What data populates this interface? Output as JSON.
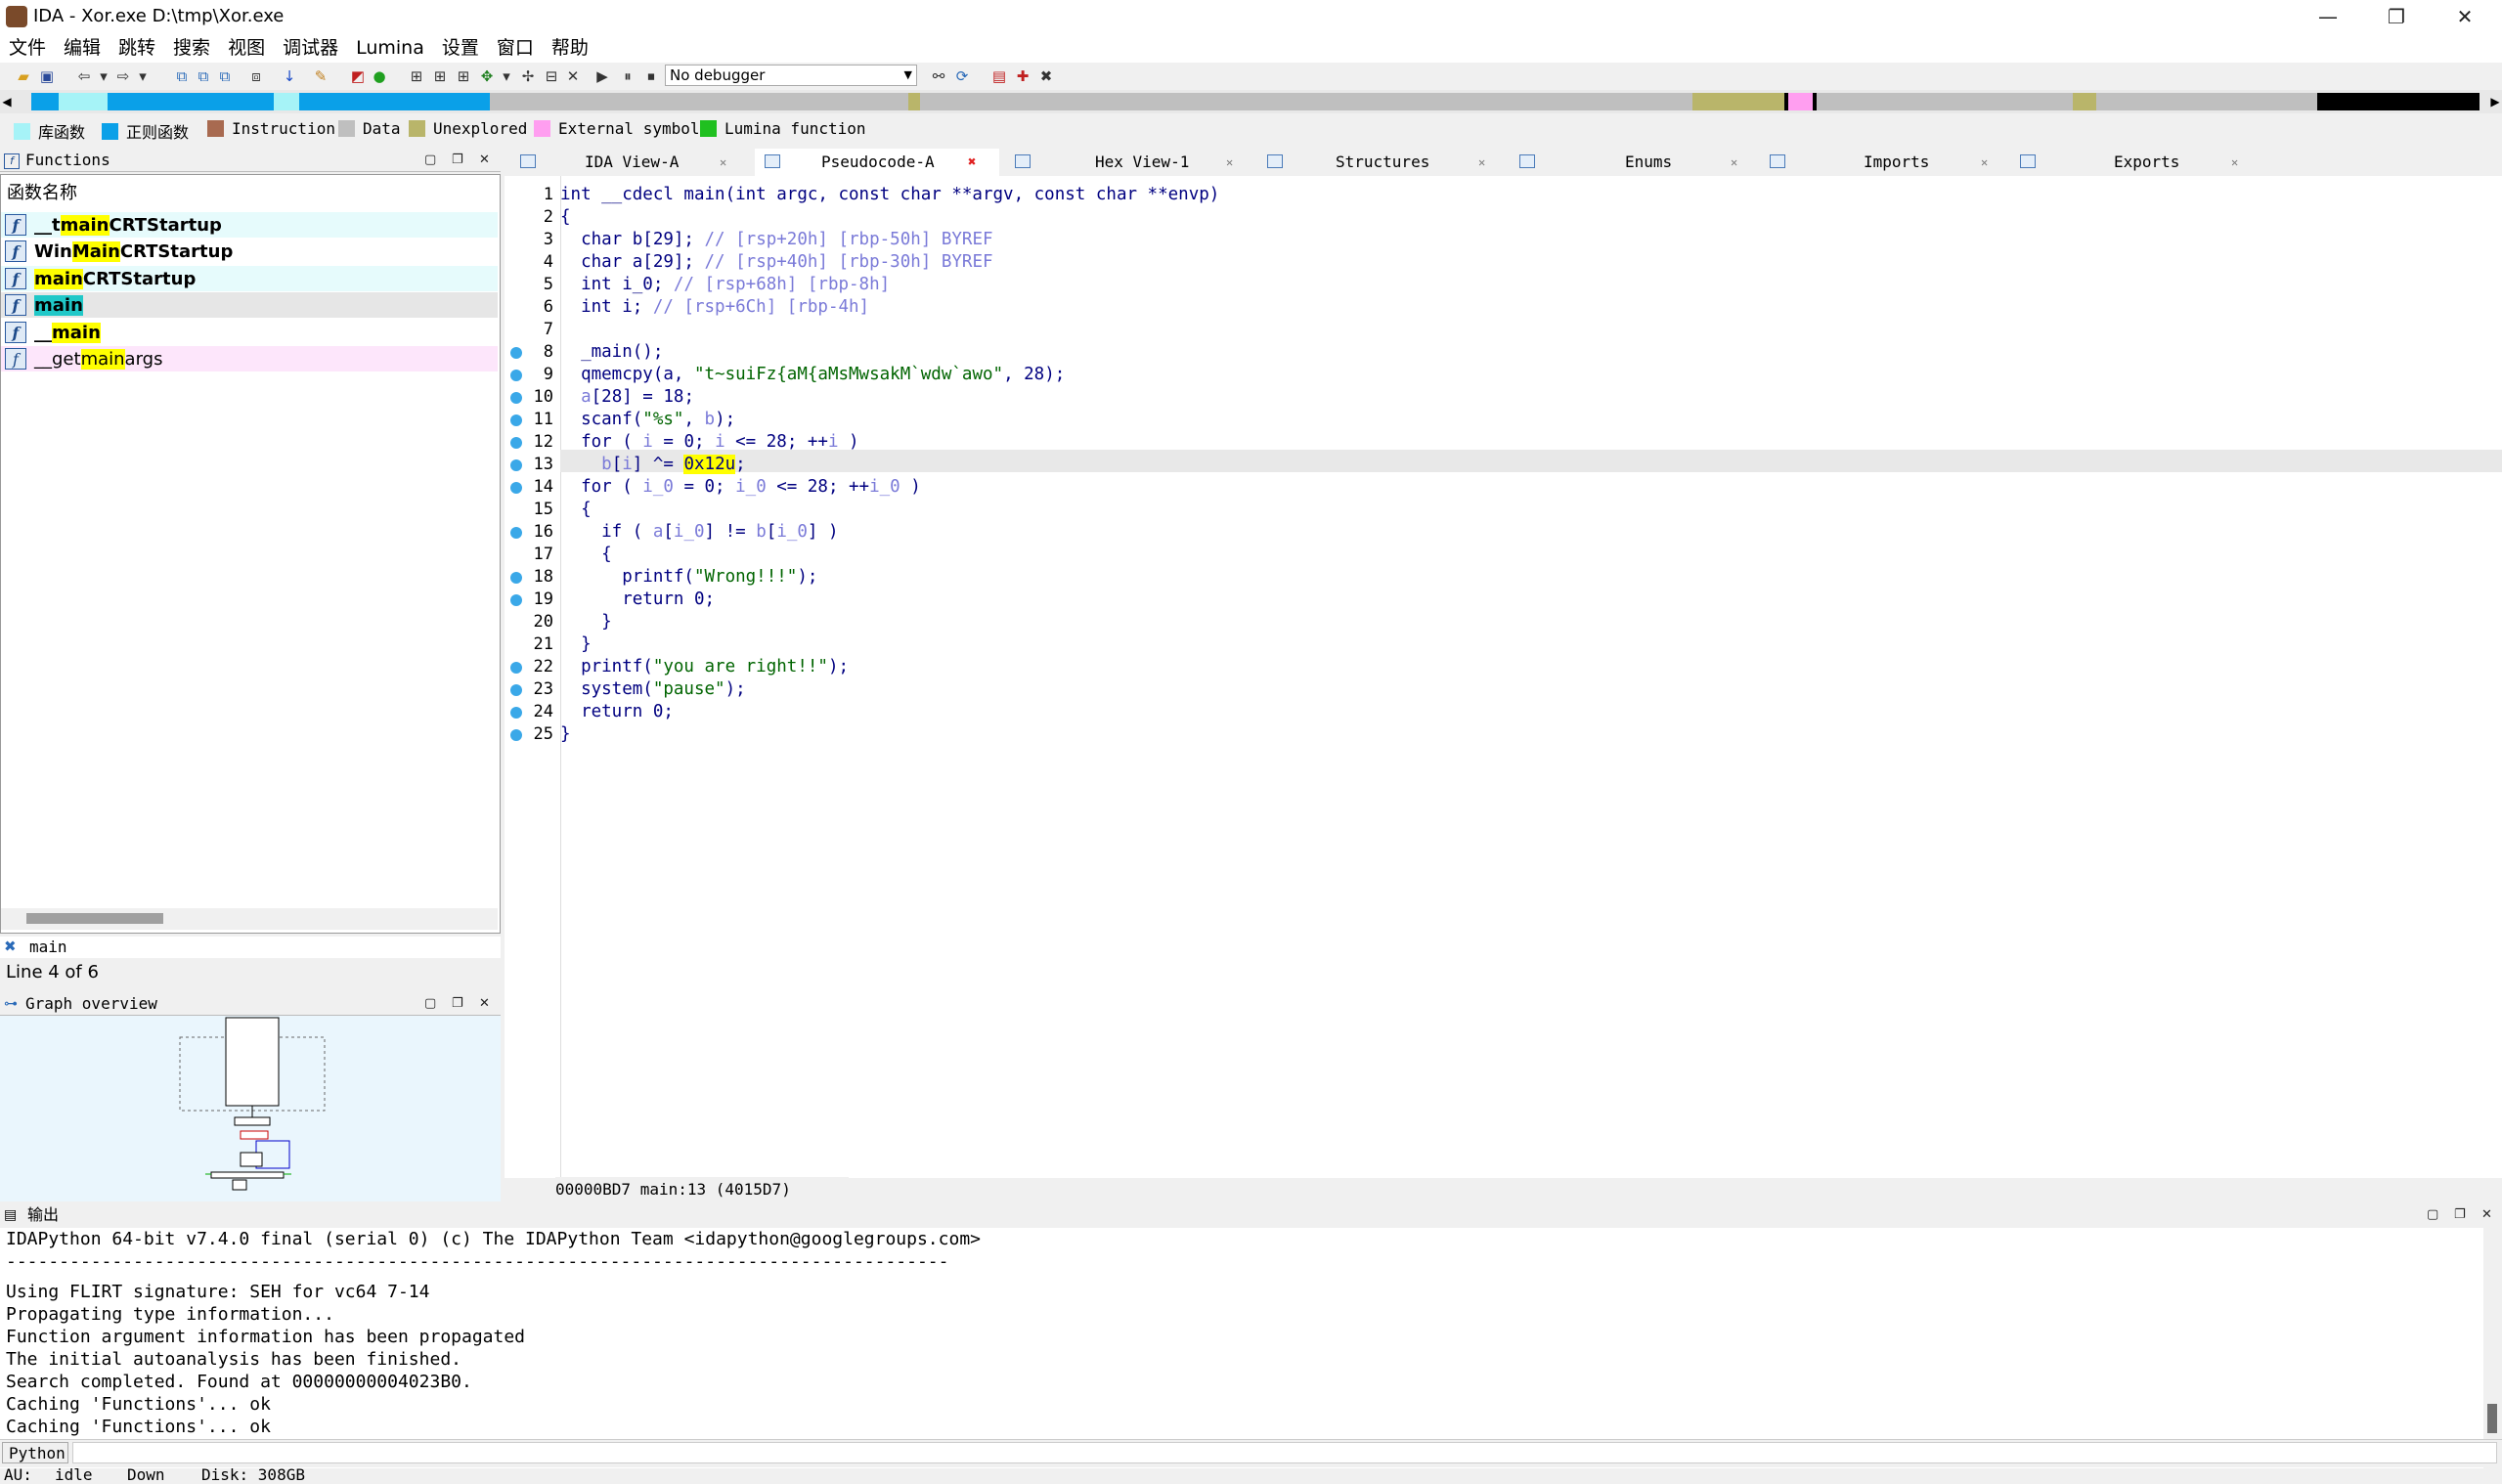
{
  "window": {
    "title": "IDA - Xor.exe D:\\tmp\\Xor.exe",
    "controls": [
      "—",
      "❐",
      "✕"
    ]
  },
  "menu": [
    "文件",
    "编辑",
    "跳转",
    "搜索",
    "视图",
    "调试器",
    "Lumina",
    "设置",
    "窗口",
    "帮助"
  ],
  "toolbar": {
    "debugger": "No debugger"
  },
  "legend": [
    {
      "label": "库函数",
      "color": "#a6f3f7"
    },
    {
      "label": "正则函数",
      "color": "#0aa0e8"
    },
    {
      "label": "Instruction",
      "color": "#a86a50"
    },
    {
      "label": "Data",
      "color": "#bfbfbf"
    },
    {
      "label": "Unexplored",
      "color": "#b9b56a"
    },
    {
      "label": "External symbol",
      "color": "#ff9ef0"
    },
    {
      "label": "Lumina function",
      "color": "#20c020"
    }
  ],
  "functions": {
    "title": "Functions",
    "column_header": "函数名称",
    "items": [
      {
        "pre": "__t",
        "hl": "main",
        "post": "CRTStartup"
      },
      {
        "pre": "Win",
        "hl": "Main",
        "post": "CRTStartup"
      },
      {
        "pre": "",
        "hl": "main",
        "post": "CRTStartup"
      },
      {
        "pre": "",
        "hl": "main",
        "post": ""
      },
      {
        "pre": "__",
        "hl": "main",
        "post": ""
      },
      {
        "pre": "__get",
        "hl": "main",
        "post": "args"
      }
    ],
    "filter": "main",
    "line_status": "Line 4 of 6"
  },
  "graph_overview": {
    "title": "Graph overview"
  },
  "tabs": [
    {
      "label": "IDA View-A"
    },
    {
      "label": "Pseudocode-A"
    },
    {
      "label": "Hex View-1"
    },
    {
      "label": "Structures"
    },
    {
      "label": "Enums"
    },
    {
      "label": "Imports"
    },
    {
      "label": "Exports"
    }
  ],
  "code": {
    "line_numbers": [
      "1",
      "2",
      "3",
      "4",
      "5",
      "6",
      "7",
      "8",
      "9",
      "10",
      "11",
      "12",
      "13",
      "14",
      "15",
      "16",
      "17",
      "18",
      "19",
      "20",
      "21",
      "22",
      "23",
      "24",
      "25"
    ],
    "lines": [
      [
        "int __cdecl main(int argc, const char **argv, const char **envp)"
      ],
      [
        "{"
      ],
      [
        "  char b[29]; ",
        "// [rsp+20h] [rbp-50h] BYREF"
      ],
      [
        "  char a[29]; ",
        "// [rsp+40h] [rbp-30h] BYREF"
      ],
      [
        "  int i_0; ",
        "// [rsp+68h] [rbp-8h]"
      ],
      [
        "  int i; ",
        "// [rsp+6Ch] [rbp-4h]"
      ],
      [
        ""
      ],
      [
        "  _main();"
      ],
      [
        "  qmemcpy(",
        "a",
        ", ",
        "\"t~suiFz{aM{aMsMwsakM`wdw`awo\"",
        ", 28);"
      ],
      [
        "  ",
        "a",
        "[28] = 18;"
      ],
      [
        "  scanf(",
        "\"%s\"",
        ", ",
        "b",
        ");"
      ],
      [
        "  for ( ",
        "i",
        " = 0; ",
        "i",
        " <= 28; ++",
        "i",
        " )"
      ],
      [
        "    ",
        "b",
        "[",
        "i",
        "] ^= ",
        "0x12u",
        ";"
      ],
      [
        "  for ( ",
        "i_0",
        " = 0; ",
        "i_0",
        " <= 28; ++",
        "i_0",
        " )"
      ],
      [
        "  {"
      ],
      [
        "    if ( ",
        "a",
        "[",
        "i_0",
        "] != ",
        "b",
        "[",
        "i_0",
        "] )"
      ],
      [
        "    {"
      ],
      [
        "      printf(",
        "\"Wrong!!!\"",
        ");"
      ],
      [
        "      return 0;"
      ],
      [
        "    }"
      ],
      [
        "  }"
      ],
      [
        "  printf(",
        "\"you are right!!\"",
        ");"
      ],
      [
        "  system(",
        "\"pause\"",
        ");"
      ],
      [
        "  return 0;"
      ],
      [
        "}"
      ]
    ],
    "address_status": "00000BD7 main:13 (4015D7)"
  },
  "output": {
    "title": "输出",
    "lines": [
      "IDAPython 64-bit v7.4.0 final (serial 0) (c) The IDAPython Team <idapython@googlegroups.com>",
      "-----------------------------------------------------------------------------------------",
      "Using FLIRT signature: SEH for vc64 7-14",
      "Propagating type information...",
      "Function argument information has been propagated",
      "The initial autoanalysis has been finished.",
      "Search completed. Found at 00000000004023B0.",
      "Caching 'Functions'... ok",
      "Caching 'Functions'... ok"
    ],
    "python_label": "Python"
  },
  "statusbar": {
    "au": "AU:",
    "state": "idle",
    "direction": "Down",
    "disk": "Disk: 308GB"
  }
}
